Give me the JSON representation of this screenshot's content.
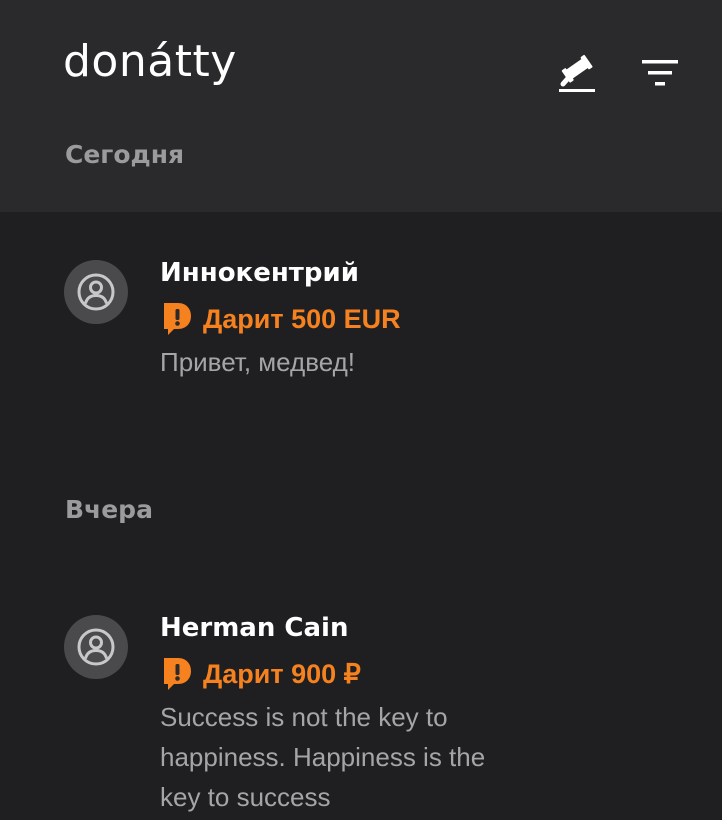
{
  "app": {
    "logo_text": "donátty"
  },
  "header": {
    "auction_icon": "auction-gavel-icon",
    "filter_icon": "filter-icon"
  },
  "sections": [
    {
      "title": "Сегодня",
      "donations": [
        {
          "name": "Иннокентрий",
          "amount": "Дарит 500 EUR",
          "message": "Привет, медвед!",
          "avatar_icon": "user-avatar-icon"
        }
      ]
    },
    {
      "title": "Вчера",
      "donations": [
        {
          "name": "Herman Cain",
          "amount": "Дарит 900 ₽",
          "message": "Success is not the key to happiness. Happiness is the key to success",
          "avatar_icon": "user-avatar-icon"
        }
      ]
    }
  ],
  "colors": {
    "background": "#1f1f22",
    "header_background": "#2a2a2d",
    "accent": "#f5821f",
    "muted_text": "#a5a5a8",
    "section_title": "#9b9b9e",
    "avatar_bg": "#4a4a4d"
  }
}
